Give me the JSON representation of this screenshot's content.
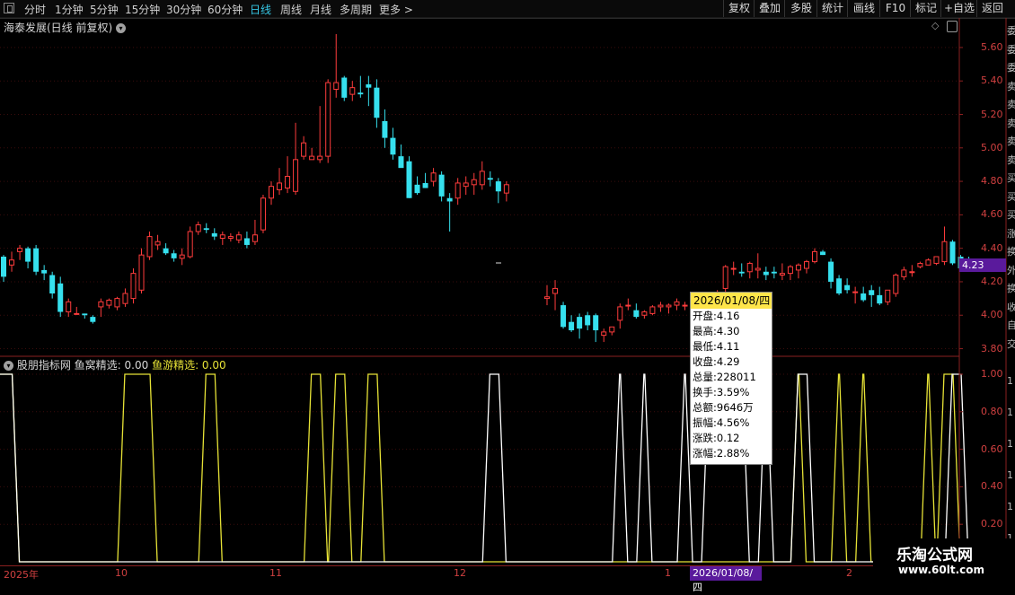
{
  "toolbar": {
    "periods": [
      "分时",
      "1分钟",
      "5分钟",
      "15分钟",
      "30分钟",
      "60分钟",
      "日线",
      "周线",
      "月线",
      "多周期",
      "更多 >"
    ],
    "active": "日线",
    "right_buttons": [
      "复权",
      "叠加",
      "多股",
      "统计",
      "画线",
      "F10",
      "标记",
      "+自选",
      "返回"
    ]
  },
  "chart_header": {
    "title": "海泰发展(日线 前复权)"
  },
  "indicator_header": {
    "name": "股朋指标网",
    "s1_label": "鱼窝精选: 0.00",
    "s2_label": "鱼游精选: 0.00"
  },
  "last_price": "4.23",
  "popup": {
    "date": "2026/01/08/四",
    "rows": [
      "开盘:4.16",
      "最高:4.30",
      "最低:4.11",
      "收盘:4.29",
      "总量:228011",
      "换手:3.59%",
      "总额:9646万",
      "振幅:4.56%",
      "涨跌:0.12",
      "涨幅:2.88%"
    ]
  },
  "x_axis": {
    "labels": [
      "2025年",
      "10",
      "11",
      "12",
      "1",
      "2"
    ],
    "cursor_label": "2026/01/08/四"
  },
  "watermark": {
    "line1": "乐淘公式网",
    "line2": "www.60lt.com"
  },
  "right_strip_chars": [
    "委",
    "委",
    "委",
    "卖",
    "卖",
    "卖",
    "卖",
    "卖",
    "买",
    "买",
    "买",
    "涨",
    "换",
    "外",
    "换",
    "收",
    "自",
    "交",
    "1",
    "1",
    "1",
    "1",
    "1",
    "1"
  ],
  "colors": {
    "up": "#ff3c3c",
    "down": "#36e0ee",
    "axis": "#c03030",
    "accent": "#36c8e6",
    "series1": "#ffffff",
    "series2": "#e6e236"
  },
  "chart_data": [
    {
      "type": "candlestick",
      "title": "海泰发展(日线 前复权)",
      "y_ticks": [
        "5.60",
        "5.40",
        "5.20",
        "5.00",
        "4.80",
        "4.60",
        "4.40",
        "4.20",
        "4.00",
        "3.80"
      ],
      "ylim": [
        3.76,
        5.68
      ],
      "ohlc": [
        [
          4.35,
          4.36,
          4.2,
          4.23
        ],
        [
          4.3,
          4.38,
          4.26,
          4.33
        ],
        [
          4.38,
          4.42,
          4.33,
          4.4
        ],
        [
          4.4,
          4.41,
          4.28,
          4.32
        ],
        [
          4.4,
          4.42,
          4.24,
          4.26
        ],
        [
          4.27,
          4.3,
          4.21,
          4.25
        ],
        [
          4.24,
          4.26,
          4.1,
          4.13
        ],
        [
          4.19,
          4.23,
          3.99,
          4.02
        ],
        [
          4.02,
          4.1,
          3.99,
          4.08
        ],
        [
          4.01,
          4.05,
          4.01,
          4.01
        ],
        [
          4.01,
          4.01,
          3.98,
          4.0
        ],
        [
          3.99,
          4.0,
          3.95,
          3.96
        ],
        [
          4.05,
          4.1,
          3.99,
          4.08
        ],
        [
          4.06,
          4.1,
          4.04,
          4.09
        ],
        [
          4.05,
          4.11,
          4.03,
          4.1
        ],
        [
          4.07,
          4.16,
          4.05,
          4.13
        ],
        [
          4.1,
          4.28,
          4.07,
          4.25
        ],
        [
          4.15,
          4.4,
          4.13,
          4.36
        ],
        [
          4.35,
          4.5,
          4.33,
          4.47
        ],
        [
          4.42,
          4.48,
          4.39,
          4.44
        ],
        [
          4.4,
          4.43,
          4.36,
          4.37
        ],
        [
          4.37,
          4.39,
          4.32,
          4.34
        ],
        [
          4.34,
          4.4,
          4.3,
          4.36
        ],
        [
          4.35,
          4.53,
          4.34,
          4.5
        ],
        [
          4.5,
          4.56,
          4.48,
          4.54
        ],
        [
          4.52,
          4.55,
          4.49,
          4.51
        ],
        [
          4.49,
          4.52,
          4.45,
          4.47
        ],
        [
          4.46,
          4.5,
          4.42,
          4.48
        ],
        [
          4.46,
          4.49,
          4.44,
          4.47
        ],
        [
          4.45,
          4.5,
          4.43,
          4.48
        ],
        [
          4.46,
          4.5,
          4.4,
          4.42
        ],
        [
          4.44,
          4.57,
          4.42,
          4.48
        ],
        [
          4.51,
          4.72,
          4.49,
          4.7
        ],
        [
          4.7,
          4.8,
          4.66,
          4.77
        ],
        [
          4.75,
          4.88,
          4.72,
          4.79
        ],
        [
          4.76,
          4.95,
          4.73,
          4.83
        ],
        [
          4.74,
          5.15,
          4.72,
          4.93
        ],
        [
          4.95,
          5.07,
          4.93,
          5.03
        ],
        [
          4.93,
          5.0,
          4.93,
          4.95
        ],
        [
          4.93,
          5.25,
          4.91,
          4.95
        ],
        [
          4.95,
          5.41,
          4.91,
          5.39
        ],
        [
          5.35,
          5.68,
          5.3,
          5.39
        ],
        [
          5.42,
          5.43,
          5.28,
          5.3
        ],
        [
          5.32,
          5.4,
          5.28,
          5.36
        ],
        [
          5.33,
          5.43,
          5.3,
          5.32
        ],
        [
          5.38,
          5.43,
          5.25,
          5.36
        ],
        [
          5.36,
          5.41,
          5.12,
          5.18
        ],
        [
          5.16,
          5.23,
          5.0,
          5.06
        ],
        [
          5.06,
          5.12,
          4.93,
          4.96
        ],
        [
          4.95,
          5.02,
          4.91,
          4.88
        ],
        [
          4.92,
          4.95,
          4.7,
          4.7
        ],
        [
          4.78,
          4.83,
          4.72,
          4.73
        ],
        [
          4.79,
          4.85,
          4.76,
          4.76
        ],
        [
          4.8,
          4.88,
          4.77,
          4.85
        ],
        [
          4.84,
          4.86,
          4.68,
          4.71
        ],
        [
          4.7,
          4.73,
          4.5,
          4.68
        ],
        [
          4.7,
          4.82,
          4.66,
          4.79
        ],
        [
          4.77,
          4.83,
          4.72,
          4.79
        ],
        [
          4.78,
          4.85,
          4.72,
          4.81
        ],
        [
          4.78,
          4.92,
          4.75,
          4.86
        ],
        [
          4.82,
          4.86,
          4.77,
          4.81
        ],
        [
          4.8,
          4.82,
          4.67,
          4.74
        ],
        [
          4.73,
          4.8,
          4.68,
          4.78
        ],
        [
          4.1,
          4.18,
          4.06,
          4.11
        ],
        [
          4.13,
          4.21,
          4.03,
          4.16
        ],
        [
          4.06,
          4.08,
          3.92,
          3.93
        ],
        [
          3.96,
          4.0,
          3.9,
          3.91
        ],
        [
          3.99,
          4.01,
          3.86,
          3.92
        ],
        [
          4.0,
          4.02,
          3.91,
          3.94
        ],
        [
          4.0,
          4.01,
          3.84,
          3.91
        ],
        [
          3.88,
          3.92,
          3.84,
          3.9
        ],
        [
          3.9,
          3.93,
          3.88,
          3.93
        ],
        [
          3.97,
          4.07,
          3.92,
          4.05
        ],
        [
          4.06,
          4.1,
          4.03,
          4.06
        ],
        [
          4.03,
          4.07,
          3.98,
          3.99
        ],
        [
          4.0,
          4.03,
          3.98,
          4.02
        ],
        [
          4.01,
          4.06,
          4.0,
          4.05
        ],
        [
          4.05,
          4.08,
          4.02,
          4.06
        ],
        [
          4.05,
          4.07,
          4.01,
          4.06
        ],
        [
          4.06,
          4.1,
          4.03,
          4.08
        ],
        [
          4.06,
          4.08,
          4.03,
          4.06
        ],
        [
          4.05,
          4.12,
          4.02,
          4.05
        ],
        [
          4.08,
          4.14,
          4.05,
          4.09
        ],
        [
          4.06,
          4.11,
          4.04,
          4.1
        ],
        [
          4.08,
          4.15,
          4.05,
          4.13
        ],
        [
          4.16,
          4.3,
          4.11,
          4.29
        ],
        [
          4.28,
          4.32,
          4.24,
          4.28
        ],
        [
          4.26,
          4.31,
          4.23,
          4.25
        ],
        [
          4.26,
          4.32,
          4.22,
          4.31
        ],
        [
          4.27,
          4.37,
          4.22,
          4.28
        ],
        [
          4.26,
          4.29,
          4.21,
          4.24
        ],
        [
          4.26,
          4.29,
          4.22,
          4.25
        ],
        [
          4.24,
          4.31,
          4.21,
          4.25
        ],
        [
          4.25,
          4.3,
          4.21,
          4.29
        ],
        [
          4.27,
          4.31,
          4.22,
          4.3
        ],
        [
          4.28,
          4.33,
          4.25,
          4.32
        ],
        [
          4.32,
          4.4,
          4.31,
          4.38
        ],
        [
          4.38,
          4.39,
          4.36,
          4.36
        ],
        [
          4.32,
          4.34,
          4.16,
          4.2
        ],
        [
          4.22,
          4.24,
          4.12,
          4.13
        ],
        [
          4.18,
          4.22,
          4.13,
          4.15
        ],
        [
          4.14,
          4.17,
          4.07,
          4.14
        ],
        [
          4.13,
          4.17,
          4.08,
          4.09
        ],
        [
          4.15,
          4.18,
          4.05,
          4.12
        ],
        [
          4.12,
          4.17,
          4.06,
          4.07
        ],
        [
          4.08,
          4.12,
          4.06,
          4.15
        ],
        [
          4.13,
          4.25,
          4.11,
          4.24
        ],
        [
          4.23,
          4.29,
          4.21,
          4.27
        ],
        [
          4.26,
          4.3,
          4.23,
          4.26
        ],
        [
          4.29,
          4.32,
          4.28,
          4.31
        ],
        [
          4.3,
          4.34,
          4.3,
          4.33
        ],
        [
          4.31,
          4.35,
          4.3,
          4.35
        ],
        [
          4.32,
          4.53,
          4.3,
          4.44
        ],
        [
          4.44,
          4.45,
          4.3,
          4.31
        ],
        [
          4.35,
          4.36,
          4.28,
          4.28
        ],
        [
          4.33,
          4.35,
          4.3,
          4.31
        ]
      ]
    },
    {
      "type": "line",
      "title": "股朋指标网",
      "y_ticks": [
        "1.00",
        "0.80",
        "0.60",
        "0.40",
        "0.20"
      ],
      "ylim": [
        0,
        1
      ],
      "series": [
        {
          "name": "鱼窝精选",
          "values": [
            1,
            1,
            0,
            0,
            0,
            0,
            0,
            0,
            0,
            0,
            0,
            0,
            0,
            0,
            0,
            0,
            0,
            0,
            0,
            0,
            0,
            0,
            0,
            0,
            0,
            0,
            0,
            0,
            0,
            0,
            0,
            0,
            0,
            0,
            0,
            0,
            0,
            0,
            0,
            0,
            0,
            0,
            0,
            0,
            0,
            0,
            0,
            0,
            0,
            0,
            0,
            0,
            0,
            0,
            0,
            0,
            0,
            0,
            0,
            0,
            1,
            1,
            0,
            0,
            0,
            0,
            0,
            0,
            0,
            0,
            0,
            0,
            1,
            0,
            0,
            1,
            0,
            0,
            0,
            0,
            1,
            0,
            0,
            1,
            1,
            1,
            1,
            1,
            0,
            0,
            1,
            0,
            0,
            0,
            1,
            1,
            0,
            0,
            0,
            0,
            0,
            0,
            0,
            0,
            0,
            0,
            0,
            0,
            0,
            0,
            0,
            0,
            0,
            1,
            1,
            0,
            1,
            0,
            0,
            0
          ]
        },
        {
          "name": "鱼游精选",
          "values": [
            1,
            1,
            0,
            0,
            0,
            0,
            0,
            0,
            0,
            0,
            0,
            0,
            0,
            0,
            0,
            1,
            1,
            1,
            1,
            0,
            0,
            0,
            0,
            0,
            0,
            1,
            1,
            0,
            0,
            0,
            0,
            0,
            0,
            0,
            0,
            0,
            0,
            0,
            1,
            1,
            0,
            1,
            1,
            0,
            0,
            1,
            1,
            0,
            0,
            0,
            0,
            0,
            0,
            0,
            0,
            0,
            0,
            0,
            0,
            0,
            0,
            0,
            0,
            0,
            0,
            0,
            0,
            0,
            0,
            0,
            0,
            0,
            0,
            0,
            0,
            0,
            0,
            0,
            0,
            0,
            0,
            0,
            0,
            0,
            0,
            0,
            0,
            0,
            0,
            0,
            0,
            0,
            0,
            0,
            1,
            0,
            0,
            0,
            0,
            1,
            0,
            0,
            1,
            0,
            0,
            0,
            0,
            0,
            0,
            0,
            1,
            0,
            1,
            1,
            0,
            0,
            1,
            0,
            0,
            1
          ]
        }
      ]
    }
  ]
}
